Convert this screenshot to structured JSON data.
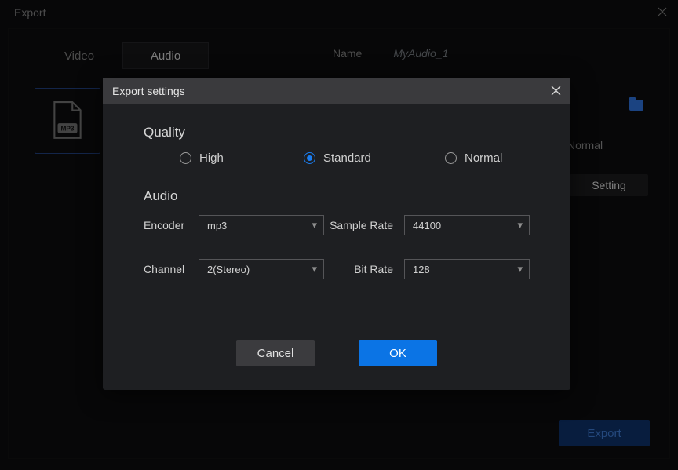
{
  "bg": {
    "window_title": "Export",
    "tabs": {
      "video": "Video",
      "audio": "Audio"
    },
    "name_label": "Name",
    "name_value": "MyAudio_1",
    "thumb_label": "MP3",
    "normal_label": "Normal",
    "setting_btn": "Setting",
    "export_btn": "Export"
  },
  "modal": {
    "title": "Export settings",
    "quality": {
      "heading": "Quality",
      "options": {
        "high": "High",
        "standard": "Standard",
        "normal": "Normal"
      },
      "selected": "standard"
    },
    "audio": {
      "heading": "Audio",
      "encoder_label": "Encoder",
      "encoder_value": "mp3",
      "samplerate_label": "Sample Rate",
      "samplerate_value": "44100",
      "channel_label": "Channel",
      "channel_value": "2(Stereo)",
      "bitrate_label": "Bit Rate",
      "bitrate_value": "128"
    },
    "cancel_btn": "Cancel",
    "ok_btn": "OK"
  }
}
